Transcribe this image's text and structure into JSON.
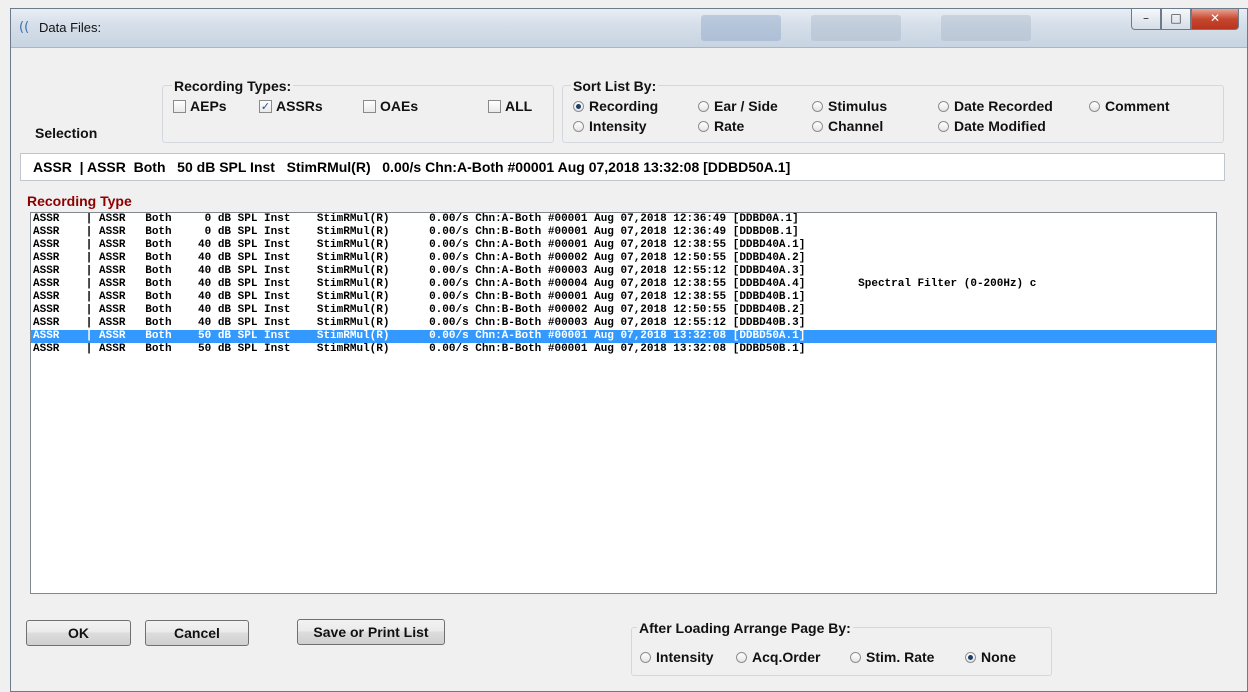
{
  "window": {
    "title": "Data Files:"
  },
  "selection_label": "Selection",
  "recording_types": {
    "title": "Recording Types:",
    "aeps": "AEPs",
    "assrs": "ASSRs",
    "oaes": "OAEs",
    "all": "ALL",
    "checked": "ASSRs"
  },
  "sort_by": {
    "title": "Sort List By:",
    "recording": "Recording",
    "ear_side": "Ear / Side",
    "stimulus": "Stimulus",
    "date_recorded": "Date Recorded",
    "comment": "Comment",
    "intensity": "Intensity",
    "rate": "Rate",
    "channel": "Channel",
    "date_modified": "Date Modified",
    "selected": "Recording"
  },
  "selection_text": "ASSR  | ASSR  Both   50 dB SPL Inst   StimRMul(R)   0.00/s Chn:A-Both #00001 Aug 07,2018 13:32:08 [DDBD50A.1]",
  "recording_type_label": "Recording Type",
  "list": {
    "selected_index": 9,
    "rows": [
      "ASSR    | ASSR   Both     0 dB SPL Inst    StimRMul(R)      0.00/s Chn:A-Both #00001 Aug 07,2018 12:36:49 [DDBD0A.1]",
      "ASSR    | ASSR   Both     0 dB SPL Inst    StimRMul(R)      0.00/s Chn:B-Both #00001 Aug 07,2018 12:36:49 [DDBD0B.1]",
      "ASSR    | ASSR   Both    40 dB SPL Inst    StimRMul(R)      0.00/s Chn:A-Both #00001 Aug 07,2018 12:38:55 [DDBD40A.1]",
      "ASSR    | ASSR   Both    40 dB SPL Inst    StimRMul(R)      0.00/s Chn:A-Both #00002 Aug 07,2018 12:50:55 [DDBD40A.2]",
      "ASSR    | ASSR   Both    40 dB SPL Inst    StimRMul(R)      0.00/s Chn:A-Both #00003 Aug 07,2018 12:55:12 [DDBD40A.3]",
      "ASSR    | ASSR   Both    40 dB SPL Inst    StimRMul(R)      0.00/s Chn:A-Both #00004 Aug 07,2018 12:38:55 [DDBD40A.4]        Spectral Filter (0-200Hz) c",
      "ASSR    | ASSR   Both    40 dB SPL Inst    StimRMul(R)      0.00/s Chn:B-Both #00001 Aug 07,2018 12:38:55 [DDBD40B.1]",
      "ASSR    | ASSR   Both    40 dB SPL Inst    StimRMul(R)      0.00/s Chn:B-Both #00002 Aug 07,2018 12:50:55 [DDBD40B.2]",
      "ASSR    | ASSR   Both    40 dB SPL Inst    StimRMul(R)      0.00/s Chn:B-Both #00003 Aug 07,2018 12:55:12 [DDBD40B.3]",
      "ASSR    | ASSR   Both    50 dB SPL Inst    StimRMul(R)      0.00/s Chn:A-Both #00001 Aug 07,2018 13:32:08 [DDBD50A.1]",
      "ASSR    | ASSR   Both    50 dB SPL Inst    StimRMul(R)      0.00/s Chn:B-Both #00001 Aug 07,2018 13:32:08 [DDBD50B.1]"
    ]
  },
  "buttons": {
    "ok": "OK",
    "cancel": "Cancel",
    "save_print": "Save or Print List"
  },
  "arrange": {
    "title": "After Loading Arrange Page By:",
    "intensity": "Intensity",
    "acq_order": "Acq.Order",
    "stim_rate": "Stim. Rate",
    "none": "None",
    "selected": "None"
  },
  "icons": {
    "window": "sound-waves-icon",
    "minimize": "minimize-icon",
    "maximize": "maximize-icon",
    "close": "close-icon"
  }
}
